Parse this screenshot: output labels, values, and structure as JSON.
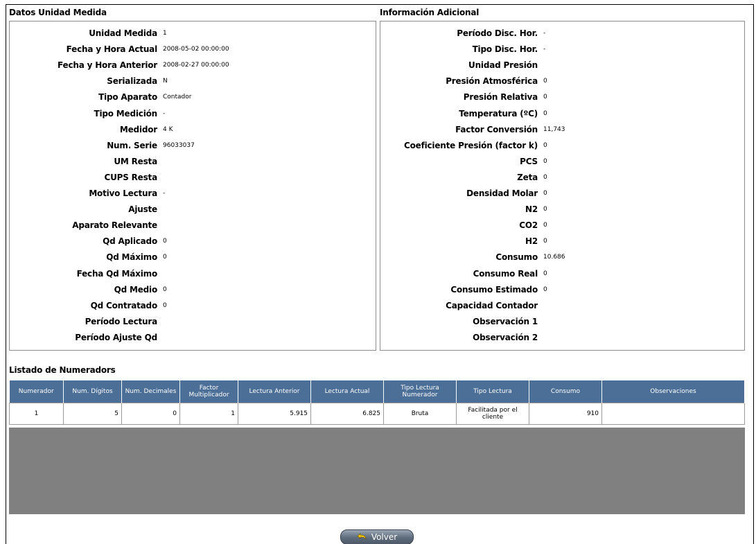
{
  "sections": {
    "left_title": "Datos Unidad Medida",
    "right_title": "Información Adicional",
    "list_title": "Listado de Numeradors"
  },
  "left_fields": [
    {
      "label": "Unidad Medida",
      "value": "1"
    },
    {
      "label": "Fecha y Hora Actual",
      "value": "2008-05-02 00:00:00"
    },
    {
      "label": "Fecha y Hora Anterior",
      "value": "2008-02-27 00:00:00"
    },
    {
      "label": "Serializada",
      "value": "N"
    },
    {
      "label": "Tipo Aparato",
      "value": "Contador"
    },
    {
      "label": "Tipo Medición",
      "value": "-"
    },
    {
      "label": "Medidor",
      "value": "4 K"
    },
    {
      "label": "Num. Serie",
      "value": "96033037"
    },
    {
      "label": "UM Resta",
      "value": ""
    },
    {
      "label": "CUPS Resta",
      "value": ""
    },
    {
      "label": "Motivo Lectura",
      "value": "-"
    },
    {
      "label": "Ajuste",
      "value": ""
    },
    {
      "label": "Aparato Relevante",
      "value": ""
    },
    {
      "label": "Qd Aplicado",
      "value": "0"
    },
    {
      "label": "Qd Máximo",
      "value": "0"
    },
    {
      "label": "Fecha Qd Máximo",
      "value": ""
    },
    {
      "label": "Qd Medio",
      "value": "0"
    },
    {
      "label": "Qd Contratado",
      "value": "0"
    },
    {
      "label": "Período Lectura",
      "value": ""
    },
    {
      "label": "Período Ajuste Qd",
      "value": ""
    }
  ],
  "right_fields": [
    {
      "label": "Período Disc. Hor.",
      "value": "-"
    },
    {
      "label": "Tipo Disc. Hor.",
      "value": "-"
    },
    {
      "label": "Unidad Presión",
      "value": ""
    },
    {
      "label": "Presión Atmosférica",
      "value": "0"
    },
    {
      "label": "Presión Relativa",
      "value": "0"
    },
    {
      "label": "Temperatura (ºC)",
      "value": "0"
    },
    {
      "label": "Factor Conversión",
      "value": "11,743"
    },
    {
      "label": "Coeficiente Presión (factor k)",
      "value": "0"
    },
    {
      "label": "PCS",
      "value": "0"
    },
    {
      "label": "Zeta",
      "value": "0"
    },
    {
      "label": "Densidad Molar",
      "value": "0"
    },
    {
      "label": "N2",
      "value": "0"
    },
    {
      "label": "CO2",
      "value": "0"
    },
    {
      "label": "H2",
      "value": "0"
    },
    {
      "label": "Consumo",
      "value": "10.686"
    },
    {
      "label": "Consumo Real",
      "value": "0"
    },
    {
      "label": "Consumo Estimado",
      "value": "0"
    },
    {
      "label": "Capacidad Contador",
      "value": ""
    },
    {
      "label": "Observación 1",
      "value": ""
    },
    {
      "label": "Observación 2",
      "value": ""
    }
  ],
  "table": {
    "headers": [
      "Numerador",
      "Num. Dígitos",
      "Num. Decimales",
      "Factor Multiplicador",
      "Lectura Anterior",
      "Lectura Actual",
      "Tipo Lectura Numerador",
      "Tipo Lectura",
      "Consumo",
      "Observaciones"
    ],
    "rows": [
      [
        "1",
        "5",
        "0",
        "1",
        "5.915",
        "6.825",
        "Bruta",
        "Facilitada por el cliente",
        "910",
        ""
      ]
    ]
  },
  "buttons": {
    "volver": "Volver",
    "volver_icon": "back-arrow-icon"
  },
  "colors": {
    "table_header": "#4c6f97",
    "empty_area": "#808080"
  }
}
